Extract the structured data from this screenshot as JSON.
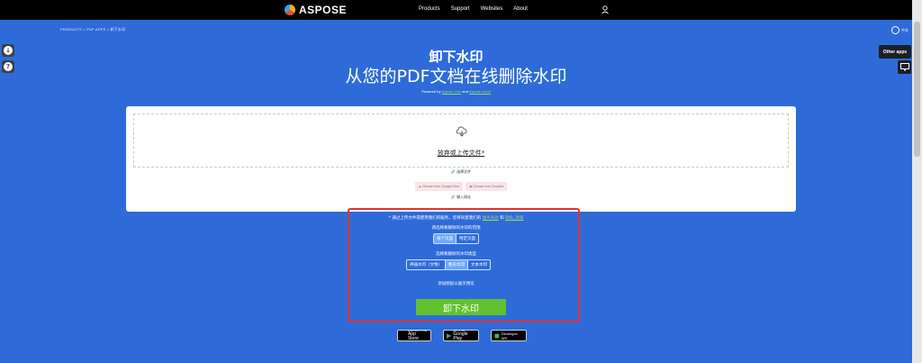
{
  "nav": {
    "logo": "ASPOSE",
    "links": [
      "Products",
      "Support",
      "Websites",
      "About"
    ]
  },
  "breadcrumb": "PRODUCTS > PDF APPS > 卸下水印",
  "lang": "中文",
  "other_apps": "Other apps",
  "hero": {
    "title": "卸下水印",
    "subtitle": "从您的PDF文档在线删除水印",
    "powered_by": "Powered by",
    "powered_link1": "aspose.com",
    "powered_and": "and",
    "powered_link2": "aspose.cloud"
  },
  "upload": {
    "drop_text": "放弃或上传文件*",
    "choose_file": "选择文件",
    "google_drive": "Choose from Google Drive",
    "dropbox": "Choose from Dropbox",
    "enter_url": "输入网址"
  },
  "options": {
    "terms_prefix": "* 通过上传文件或使用我们的服务，您将同意我们的",
    "terms_link": "服务条款",
    "terms_and": "和",
    "privacy_link": "隐私_政策",
    "scope_label": "请选择要删除的水印的范围",
    "scope_options": [
      "每个页面",
      "特定页面"
    ],
    "type_label": "选择要删除的水印类型",
    "type_options": [
      "神器水印（文物）",
      "象形水印",
      "文本水印"
    ],
    "preview_text": "添加图层以展示预览"
  },
  "action": {
    "remove_label": "卸下水印"
  },
  "badges": {
    "appstore_small": "Download on the",
    "appstore_big": "App Store",
    "googleplay_small": "GET IT ON",
    "googleplay_big": "Google Play",
    "developer_api": "Developer API"
  },
  "colors": {
    "background": "#2e6bd8",
    "accent_green": "#63c12f",
    "highlight_red": "#e3342f"
  }
}
